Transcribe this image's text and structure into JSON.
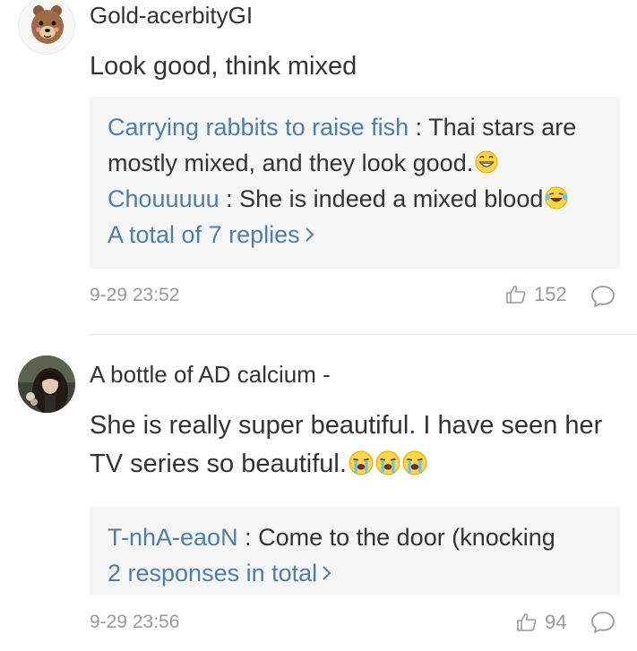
{
  "comments": [
    {
      "username": "Gold-acerbityGI",
      "body": "Look good, think mixed",
      "replies": [
        {
          "user": "Carrying rabbits to raise fish",
          "text": " : Thai stars are mostly mixed, and they look good.",
          "emoji": "grin-emoji"
        },
        {
          "user": "Chouuuuu",
          "text": " : She is indeed a mixed blood",
          "emoji": "laugh-tears-emoji"
        }
      ],
      "more_replies": "A total of 7 replies",
      "time": "9-29 23:52",
      "likes": "152"
    },
    {
      "username": "A bottle of AD calcium -",
      "body": "She is really super beautiful. I have seen her TV series so beautiful.",
      "replies": [
        {
          "user": "T-nhA-eaoN",
          "text": " : Come to the door (knocking"
        }
      ],
      "more_replies": "2 responses in total",
      "time": "9-29 23:56",
      "likes": "94"
    }
  ],
  "icons": {
    "like": "thumbs-up-icon",
    "reply": "comment-bubble-icon",
    "chevron": "chevron-right-icon"
  },
  "colors": {
    "link": "#4d7eab",
    "muted": "#999999",
    "reply_bg": "#f6f6f6"
  }
}
